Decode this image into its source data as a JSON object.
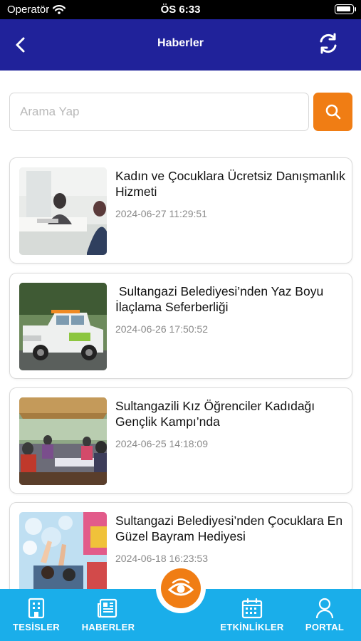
{
  "status_bar": {
    "carrier": "Operatör",
    "time": "ÖS 6:33"
  },
  "header": {
    "title": "Haberler",
    "back_icon": "chevron-left-icon",
    "refresh_icon": "refresh-icon"
  },
  "search": {
    "placeholder": "Arama Yap",
    "value": "",
    "button_icon": "search-icon"
  },
  "news": [
    {
      "title": "Kadın ve Çocuklara Ücretsiz Danışmanlık Hizmeti",
      "date": "2024-06-27 11:29:51"
    },
    {
      "title": " Sultangazi Belediyesi’nden Yaz Boyu İlaçlama Seferberliği",
      "date": "2024-06-26 17:50:52"
    },
    {
      "title": "Sultangazili Kız Öğrenciler Kadıdağı Gençlik Kampı’nda",
      "date": "2024-06-25 14:18:09"
    },
    {
      "title": "Sultangazi Belediyesi’nden Çocuklara En Güzel Bayram Hediyesi",
      "date": "2024-06-18 16:23:53"
    }
  ],
  "bottom_nav": {
    "items": [
      {
        "label": "TESİSLER",
        "icon": "building-icon"
      },
      {
        "label": "HABERLER",
        "icon": "newspaper-icon"
      },
      {
        "label": "ETKİNLİKLER",
        "icon": "calendar-icon"
      },
      {
        "label": "PORTAL",
        "icon": "user-icon"
      }
    ],
    "center_icon": "eye-logo-icon"
  },
  "colors": {
    "header": "#20229a",
    "accent": "#f07d14",
    "bottom_nav": "#1aaeea"
  }
}
